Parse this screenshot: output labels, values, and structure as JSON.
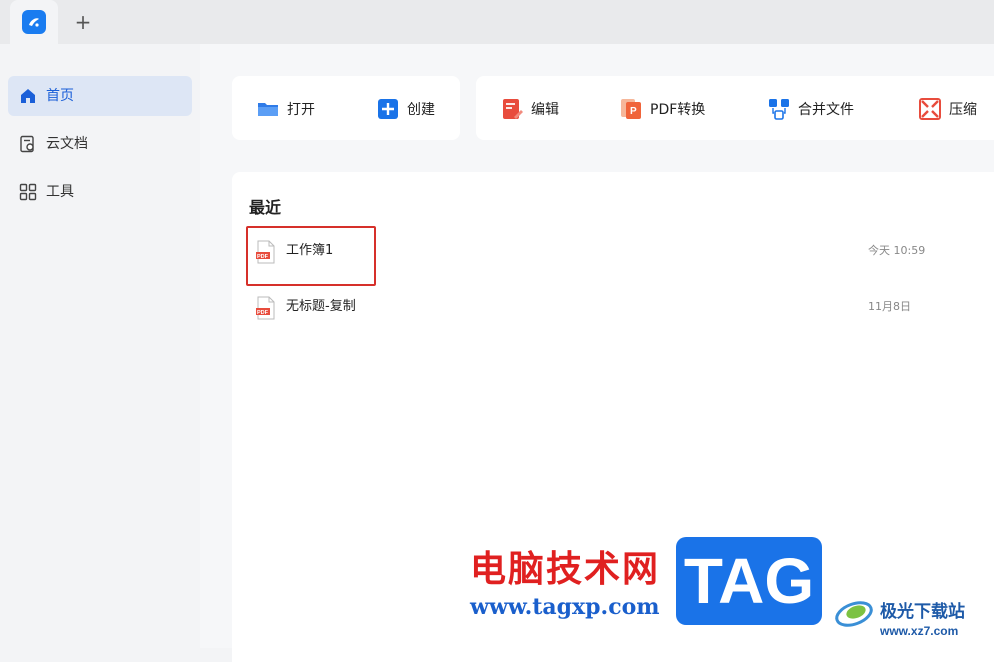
{
  "tabs": {
    "new_tab_label": "+"
  },
  "sidebar": {
    "items": [
      {
        "label": "首页",
        "icon": "home-icon",
        "active": true
      },
      {
        "label": "云文档",
        "icon": "cloud-document-icon",
        "active": false
      },
      {
        "label": "工具",
        "icon": "tools-grid-icon",
        "active": false
      }
    ]
  },
  "toolbar": {
    "open_label": "打开",
    "create_label": "创建",
    "edit_label": "编辑",
    "pdf_convert_label": "PDF转换",
    "merge_label": "合并文件",
    "compress_label": "压缩"
  },
  "recent": {
    "title": "最近",
    "files": [
      {
        "name": "工作簿1",
        "date": "今天 10:59",
        "icon": "pdf-file-icon"
      },
      {
        "name": "无标题-复制",
        "date": "11月8日",
        "icon": "pdf-file-icon"
      }
    ]
  },
  "watermark": {
    "cn_text": "电脑技术网",
    "url": "www.tagxp.com",
    "tag": "TAG",
    "site_name": "极光下载站",
    "site_url": "www.xz7.com"
  },
  "colors": {
    "accent": "#1a7cf0",
    "highlight_box": "#d6302a",
    "pdf_red": "#e84c3d"
  }
}
